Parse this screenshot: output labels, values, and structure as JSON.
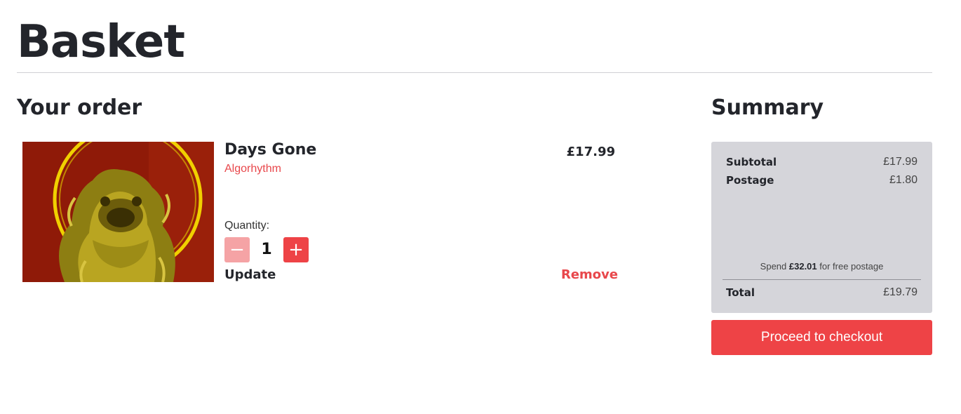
{
  "page": {
    "title": "Basket"
  },
  "order": {
    "heading": "Your order",
    "item": {
      "name": "Days Gone",
      "artist": "Algorhythm",
      "price": "£17.99",
      "quantity_label": "Quantity:",
      "quantity": "1",
      "decrement_symbol": "−",
      "increment_symbol": "+",
      "update_label": "Update",
      "remove_label": "Remove",
      "image_icon": "lion-statue-artwork"
    }
  },
  "summary": {
    "heading": "Summary",
    "subtotal_label": "Subtotal",
    "subtotal_value": "£17.99",
    "postage_label": "Postage",
    "postage_value": "£1.80",
    "free_postage_prefix": "Spend ",
    "free_postage_amount": "£32.01",
    "free_postage_suffix": " for free postage",
    "total_label": "Total",
    "total_value": "£19.79",
    "checkout_label": "Proceed to checkout"
  },
  "colors": {
    "accent": "#ee4346",
    "accent_light": "#f5a3a5",
    "summary_bg": "#d5d5da",
    "text_dark": "#23252b"
  }
}
